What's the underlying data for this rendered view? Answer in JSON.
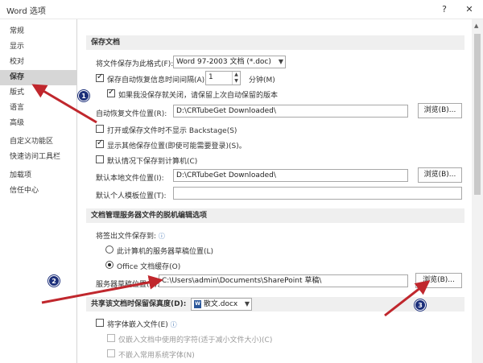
{
  "window": {
    "title": "Word 选项",
    "help_glyph": "?",
    "close_glyph": "✕"
  },
  "sidebar": {
    "items": [
      {
        "label": "常规"
      },
      {
        "label": "显示"
      },
      {
        "label": "校对"
      },
      {
        "label": "保存"
      },
      {
        "label": "版式"
      },
      {
        "label": "语言"
      },
      {
        "label": "高级"
      },
      {
        "label": "自定义功能区"
      },
      {
        "label": "快速访问工具栏"
      },
      {
        "label": "加载项"
      },
      {
        "label": "信任中心"
      }
    ],
    "active_index": 3
  },
  "save_docs": {
    "header": "保存文档",
    "format_label": "将文件保存为此格式(F):",
    "format_value": "Word 97-2003 文档 (*.doc)",
    "autorecover_label": "保存自动恢复信息时间间隔(A)",
    "autorecover_checked": true,
    "autorecover_minutes": "1",
    "minutes_label": "分钟(M)",
    "keep_last_label": "如果我没保存就关闭，请保留上次自动保留的版本",
    "keep_last_checked": true,
    "autorecover_location_label": "自动恢复文件位置(R):",
    "autorecover_location_value": "D:\\CRTubeGet Downloaded\\",
    "browse_label": "浏览(B)...",
    "no_backstage_label": "打开或保存文件时不显示 Backstage(S)",
    "no_backstage_checked": false,
    "show_other_label": "显示其他保存位置(即使可能需要登录)(S)。",
    "show_other_checked": true,
    "save_computer_label": "默认情况下保存到计算机(C)",
    "save_computer_checked": false,
    "local_location_label": "默认本地文件位置(I):",
    "local_location_value": "D:\\CRTubeGet Downloaded\\",
    "template_location_label": "默认个人模板位置(T):",
    "template_location_value": ""
  },
  "offline": {
    "header": "文档管理服务器文件的脱机编辑选项",
    "checkout_label": "将签出文件保存到:",
    "opt_server_label": "此计算机的服务器草稿位置(L)",
    "opt_server_checked": false,
    "opt_office_label": "Office 文档缓存(O)",
    "opt_office_checked": true,
    "drafts_label": "服务器草稿位置(V):",
    "drafts_value": "C:\\Users\\admin\\Documents\\SharePoint 草稿\\",
    "browse_label": "浏览(B)..."
  },
  "fidelity": {
    "header": "共享该文档时保留保真度(D):",
    "doc_name": "散文.docx",
    "embed_fonts_label": "将字体嵌入文件(E)",
    "embed_fonts_checked": false,
    "embed_used_label": "仅嵌入文档中使用的字符(适于减小文件大小)(C)",
    "no_common_label": "不嵌入常用系统字体(N)"
  },
  "annotations": {
    "badge1": "1",
    "badge2": "2",
    "badge3": "3",
    "color": "#c0272d"
  }
}
